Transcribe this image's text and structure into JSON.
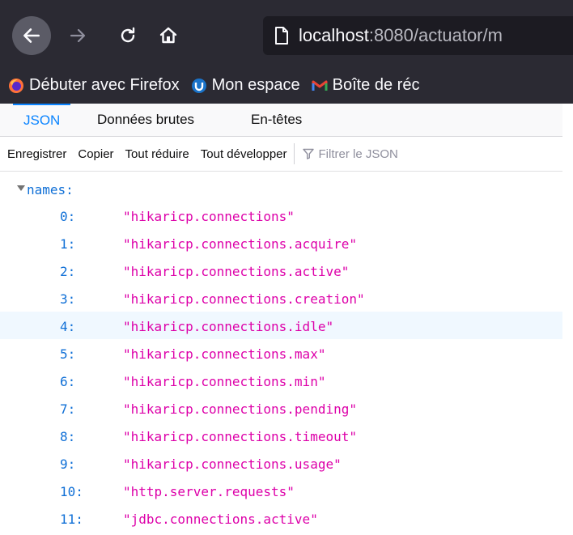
{
  "toolbar": {
    "url_host": "localhost",
    "url_rest": ":8080/actuator/m"
  },
  "bookmarks": [
    {
      "label": "Débuter avec Firefox",
      "icon": "firefox-icon"
    },
    {
      "label": "Mon espace",
      "icon": "mon-espace-icon"
    },
    {
      "label": "Boîte de réc",
      "icon": "gmail-icon"
    }
  ],
  "viewer": {
    "tabs": [
      "JSON",
      "Données brutes",
      "En-têtes"
    ],
    "actions": [
      "Enregistrer",
      "Copier",
      "Tout réduire",
      "Tout développer"
    ],
    "filter_placeholder": "Filtrer le JSON"
  },
  "json": {
    "root_key": "names:",
    "rows": [
      {
        "key": "0:",
        "value": "\"hikaricp.connections\""
      },
      {
        "key": "1:",
        "value": "\"hikaricp.connections.acquire\""
      },
      {
        "key": "2:",
        "value": "\"hikaricp.connections.active\""
      },
      {
        "key": "3:",
        "value": "\"hikaricp.connections.creation\""
      },
      {
        "key": "4:",
        "value": "\"hikaricp.connections.idle\""
      },
      {
        "key": "5:",
        "value": "\"hikaricp.connections.max\""
      },
      {
        "key": "6:",
        "value": "\"hikaricp.connections.min\""
      },
      {
        "key": "7:",
        "value": "\"hikaricp.connections.pending\""
      },
      {
        "key": "8:",
        "value": "\"hikaricp.connections.timeout\""
      },
      {
        "key": "9:",
        "value": "\"hikaricp.connections.usage\""
      },
      {
        "key": "10:",
        "value": "\"http.server.requests\""
      },
      {
        "key": "11:",
        "value": "\"jdbc.connections.active\""
      }
    ]
  },
  "colors": {
    "toolbar_bg": "#2b2a33",
    "accent": "#0a84ff",
    "json_key": "#0f6fd6",
    "json_string": "#dd00a9",
    "row_highlight": "#f0f8ff"
  }
}
